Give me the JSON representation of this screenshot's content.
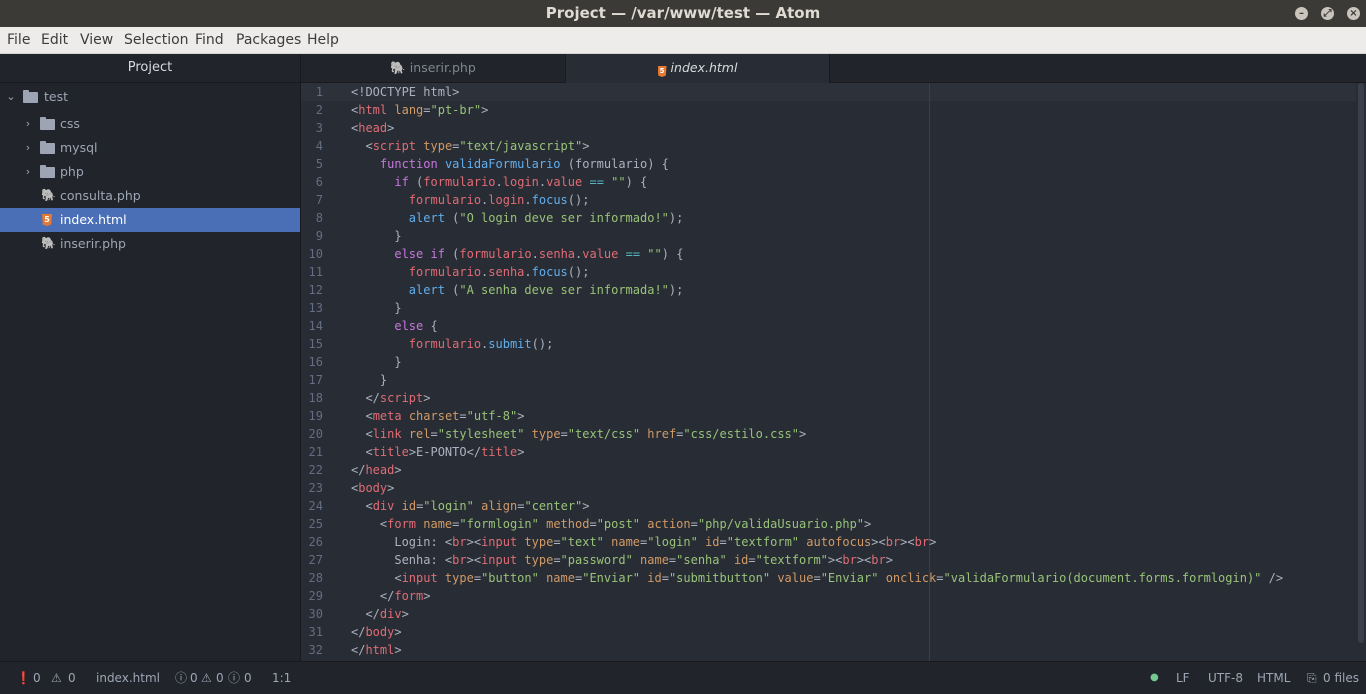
{
  "window": {
    "title": "Project — /var/www/test — Atom",
    "buttons": [
      "minimize",
      "maximize",
      "close"
    ]
  },
  "menu": [
    "File",
    "Edit",
    "View",
    "Selection",
    "Find",
    "Packages",
    "Help"
  ],
  "sidebar": {
    "header": "Project",
    "root": "test",
    "items": [
      {
        "label": "css",
        "type": "folder"
      },
      {
        "label": "mysql",
        "type": "folder"
      },
      {
        "label": "php",
        "type": "folder"
      },
      {
        "label": "consulta.php",
        "type": "php"
      },
      {
        "label": "index.html",
        "type": "html",
        "selected": true
      },
      {
        "label": "inserir.php",
        "type": "php"
      }
    ]
  },
  "tabs": [
    {
      "label": "inserir.php",
      "icon": "php-icon",
      "active": false
    },
    {
      "label": "index.html",
      "icon": "html5-icon",
      "active": true
    }
  ],
  "editor": {
    "lines": [
      [
        [
          "txt",
          "<!DOCTYPE html>"
        ]
      ],
      [
        [
          "txt",
          "<"
        ],
        [
          "tag",
          "html"
        ],
        [
          "attr",
          " lang"
        ],
        [
          "txt",
          "="
        ],
        [
          "str",
          "\"pt-br\""
        ],
        [
          "txt",
          ">"
        ]
      ],
      [
        [
          "txt",
          "<"
        ],
        [
          "tag",
          "head"
        ],
        [
          "txt",
          ">"
        ]
      ],
      [
        [
          "txt",
          "  <"
        ],
        [
          "tag",
          "script"
        ],
        [
          "attr",
          " type"
        ],
        [
          "txt",
          "="
        ],
        [
          "str",
          "\"text/javascript\""
        ],
        [
          "txt",
          ">"
        ]
      ],
      [
        [
          "txt",
          "    "
        ],
        [
          "kw",
          "function"
        ],
        [
          "txt",
          " "
        ],
        [
          "fn",
          "validaFormulario"
        ],
        [
          "txt",
          " (formulario) {"
        ]
      ],
      [
        [
          "txt",
          "      "
        ],
        [
          "kw",
          "if"
        ],
        [
          "txt",
          " ("
        ],
        [
          "prop",
          "formulario"
        ],
        [
          "txt",
          "."
        ],
        [
          "prop",
          "login"
        ],
        [
          "txt",
          "."
        ],
        [
          "prop",
          "value"
        ],
        [
          "txt",
          " "
        ],
        [
          "op",
          "=="
        ],
        [
          "txt",
          " "
        ],
        [
          "str",
          "\"\""
        ],
        [
          "txt",
          ") {"
        ]
      ],
      [
        [
          "txt",
          "        "
        ],
        [
          "prop",
          "formulario"
        ],
        [
          "txt",
          "."
        ],
        [
          "prop",
          "login"
        ],
        [
          "txt",
          "."
        ],
        [
          "fn",
          "focus"
        ],
        [
          "txt",
          "();"
        ]
      ],
      [
        [
          "txt",
          "        "
        ],
        [
          "fn",
          "alert"
        ],
        [
          "txt",
          " ("
        ],
        [
          "str",
          "\"O login deve ser informado!\""
        ],
        [
          "txt",
          ");"
        ]
      ],
      [
        [
          "txt",
          "      }"
        ]
      ],
      [
        [
          "txt",
          "      "
        ],
        [
          "kw",
          "else"
        ],
        [
          "txt",
          " "
        ],
        [
          "kw",
          "if"
        ],
        [
          "txt",
          " ("
        ],
        [
          "prop",
          "formulario"
        ],
        [
          "txt",
          "."
        ],
        [
          "prop",
          "senha"
        ],
        [
          "txt",
          "."
        ],
        [
          "prop",
          "value"
        ],
        [
          "txt",
          " "
        ],
        [
          "op",
          "=="
        ],
        [
          "txt",
          " "
        ],
        [
          "str",
          "\"\""
        ],
        [
          "txt",
          ") {"
        ]
      ],
      [
        [
          "txt",
          "        "
        ],
        [
          "prop",
          "formulario"
        ],
        [
          "txt",
          "."
        ],
        [
          "prop",
          "senha"
        ],
        [
          "txt",
          "."
        ],
        [
          "fn",
          "focus"
        ],
        [
          "txt",
          "();"
        ]
      ],
      [
        [
          "txt",
          "        "
        ],
        [
          "fn",
          "alert"
        ],
        [
          "txt",
          " ("
        ],
        [
          "str",
          "\"A senha deve ser informada!\""
        ],
        [
          "txt",
          ");"
        ]
      ],
      [
        [
          "txt",
          "      }"
        ]
      ],
      [
        [
          "txt",
          "      "
        ],
        [
          "kw",
          "else"
        ],
        [
          "txt",
          " {"
        ]
      ],
      [
        [
          "txt",
          "        "
        ],
        [
          "prop",
          "formulario"
        ],
        [
          "txt",
          "."
        ],
        [
          "fn",
          "submit"
        ],
        [
          "txt",
          "();"
        ]
      ],
      [
        [
          "txt",
          "      }"
        ]
      ],
      [
        [
          "txt",
          "    }"
        ]
      ],
      [
        [
          "txt",
          "  </"
        ],
        [
          "tag",
          "script"
        ],
        [
          "txt",
          ">"
        ]
      ],
      [
        [
          "txt",
          "  <"
        ],
        [
          "tag",
          "meta"
        ],
        [
          "attr",
          " charset"
        ],
        [
          "txt",
          "="
        ],
        [
          "str",
          "\"utf-8\""
        ],
        [
          "txt",
          ">"
        ]
      ],
      [
        [
          "txt",
          "  <"
        ],
        [
          "tag",
          "link"
        ],
        [
          "attr",
          " rel"
        ],
        [
          "txt",
          "="
        ],
        [
          "str",
          "\"stylesheet\""
        ],
        [
          "attr",
          " type"
        ],
        [
          "txt",
          "="
        ],
        [
          "str",
          "\"text/css\""
        ],
        [
          "attr",
          " href"
        ],
        [
          "txt",
          "="
        ],
        [
          "str",
          "\"css/estilo.css\""
        ],
        [
          "txt",
          ">"
        ]
      ],
      [
        [
          "txt",
          "  <"
        ],
        [
          "tag",
          "title"
        ],
        [
          "txt",
          ">E-PONTO</"
        ],
        [
          "tag",
          "title"
        ],
        [
          "txt",
          ">"
        ]
      ],
      [
        [
          "txt",
          "</"
        ],
        [
          "tag",
          "head"
        ],
        [
          "txt",
          ">"
        ]
      ],
      [
        [
          "txt",
          "<"
        ],
        [
          "tag",
          "body"
        ],
        [
          "txt",
          ">"
        ]
      ],
      [
        [
          "txt",
          "  <"
        ],
        [
          "tag",
          "div"
        ],
        [
          "attr",
          " id"
        ],
        [
          "txt",
          "="
        ],
        [
          "str",
          "\"login\""
        ],
        [
          "attr",
          " align"
        ],
        [
          "txt",
          "="
        ],
        [
          "str",
          "\"center\""
        ],
        [
          "txt",
          ">"
        ]
      ],
      [
        [
          "txt",
          "    <"
        ],
        [
          "tag",
          "form"
        ],
        [
          "attr",
          " name"
        ],
        [
          "txt",
          "="
        ],
        [
          "str",
          "\"formlogin\""
        ],
        [
          "attr",
          " method"
        ],
        [
          "txt",
          "="
        ],
        [
          "str",
          "\"post\""
        ],
        [
          "attr",
          " action"
        ],
        [
          "txt",
          "="
        ],
        [
          "str",
          "\"php/validaUsuario.php\""
        ],
        [
          "txt",
          ">"
        ]
      ],
      [
        [
          "txt",
          "      Login: <"
        ],
        [
          "tag",
          "br"
        ],
        [
          "txt",
          "><"
        ],
        [
          "tag",
          "input"
        ],
        [
          "attr",
          " type"
        ],
        [
          "txt",
          "="
        ],
        [
          "str",
          "\"text\""
        ],
        [
          "attr",
          " name"
        ],
        [
          "txt",
          "="
        ],
        [
          "str",
          "\"login\""
        ],
        [
          "attr",
          " id"
        ],
        [
          "txt",
          "="
        ],
        [
          "str",
          "\"textform\""
        ],
        [
          "attr",
          " autofocus"
        ],
        [
          "txt",
          "><"
        ],
        [
          "tag",
          "br"
        ],
        [
          "txt",
          "><"
        ],
        [
          "tag",
          "br"
        ],
        [
          "txt",
          ">"
        ]
      ],
      [
        [
          "txt",
          "      Senha: <"
        ],
        [
          "tag",
          "br"
        ],
        [
          "txt",
          "><"
        ],
        [
          "tag",
          "input"
        ],
        [
          "attr",
          " type"
        ],
        [
          "txt",
          "="
        ],
        [
          "str",
          "\"password\""
        ],
        [
          "attr",
          " name"
        ],
        [
          "txt",
          "="
        ],
        [
          "str",
          "\"senha\""
        ],
        [
          "attr",
          " id"
        ],
        [
          "txt",
          "="
        ],
        [
          "str",
          "\"textform\""
        ],
        [
          "txt",
          "><"
        ],
        [
          "tag",
          "br"
        ],
        [
          "txt",
          "><"
        ],
        [
          "tag",
          "br"
        ],
        [
          "txt",
          ">"
        ]
      ],
      [
        [
          "txt",
          "      <"
        ],
        [
          "tag",
          "input"
        ],
        [
          "attr",
          " type"
        ],
        [
          "txt",
          "="
        ],
        [
          "str",
          "\"button\""
        ],
        [
          "attr",
          " name"
        ],
        [
          "txt",
          "="
        ],
        [
          "str",
          "\"Enviar\""
        ],
        [
          "attr",
          " id"
        ],
        [
          "txt",
          "="
        ],
        [
          "str",
          "\"submitbutton\""
        ],
        [
          "attr",
          " value"
        ],
        [
          "txt",
          "="
        ],
        [
          "str",
          "\"Enviar\""
        ],
        [
          "attr",
          " onclick"
        ],
        [
          "txt",
          "="
        ],
        [
          "str",
          "\"validaFormulario(document.forms.formlogin)\""
        ],
        [
          "txt",
          " />"
        ]
      ],
      [
        [
          "txt",
          "    </"
        ],
        [
          "tag",
          "form"
        ],
        [
          "txt",
          ">"
        ]
      ],
      [
        [
          "txt",
          "  </"
        ],
        [
          "tag",
          "div"
        ],
        [
          "txt",
          ">"
        ]
      ],
      [
        [
          "txt",
          "</"
        ],
        [
          "tag",
          "body"
        ],
        [
          "txt",
          ">"
        ]
      ],
      [
        [
          "txt",
          "</"
        ],
        [
          "tag",
          "html"
        ],
        [
          "txt",
          ">"
        ]
      ]
    ]
  },
  "status": {
    "errors": "0",
    "warnings": "0",
    "file": "index.html",
    "lint_errors": "0",
    "lint_warnings": "0",
    "lint_info": "0",
    "cursor": "1:1",
    "line_ending": "LF",
    "encoding": "UTF-8",
    "grammar": "HTML",
    "git_files": "0 files"
  }
}
